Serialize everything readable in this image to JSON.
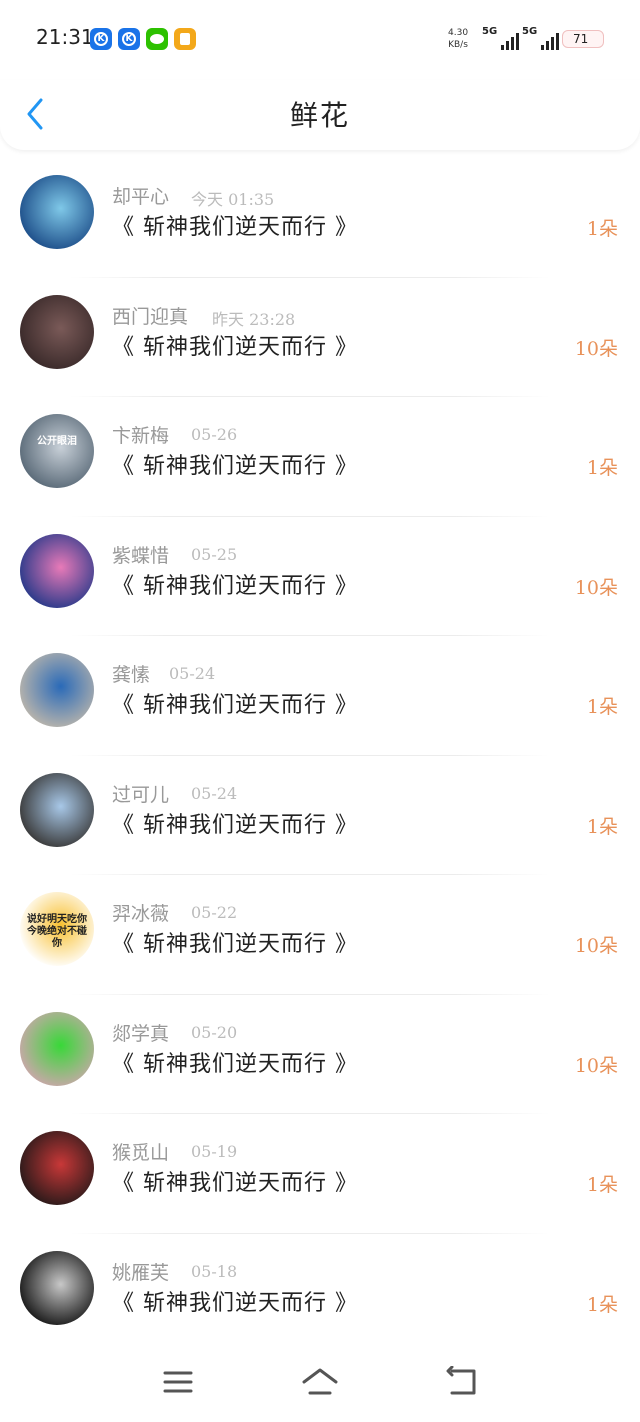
{
  "status_bar": {
    "time": "21:31",
    "net_speed_value": "4.30",
    "net_speed_unit": "KB/s",
    "signal1": "5G",
    "signal2": "5G",
    "battery": "71"
  },
  "header": {
    "title": "鲜花",
    "back_icon": "chevron-left-icon"
  },
  "entries": [
    {
      "name": "却平心",
      "date": "今天 01:35",
      "book": "《 斩神我们逆天而行 》",
      "amount": "1朵",
      "avatar_colors": [
        "#1e4f8a",
        "#7fc8e8"
      ]
    },
    {
      "name": "西门迎真",
      "date": "昨天 23:28",
      "book": "《 斩神我们逆天而行 》",
      "amount": "10朵",
      "avatar_colors": [
        "#3a2a2a",
        "#7a5a58"
      ]
    },
    {
      "name": "卞新梅",
      "date": "05-26",
      "book": "《 斩神我们逆天而行 》",
      "amount": "1朵",
      "avatar_colors": [
        "#5a6a78",
        "#c8d0d8"
      ],
      "avatar_text": "公开眼泪"
    },
    {
      "name": "紫蝶惜",
      "date": "05-25",
      "book": "《 斩神我们逆天而行 》",
      "amount": "10朵",
      "avatar_colors": [
        "#2a3a8a",
        "#e87ab8"
      ]
    },
    {
      "name": "龚愫",
      "date": "05-24",
      "book": "《 斩神我们逆天而行 》",
      "amount": "1朵",
      "avatar_colors": [
        "#b8b4ac",
        "#2a6ab8"
      ]
    },
    {
      "name": "过可儿",
      "date": "05-24",
      "book": "《 斩神我们逆天而行 》",
      "amount": "1朵",
      "avatar_colors": [
        "#3a3a3a",
        "#a8c8e8"
      ]
    },
    {
      "name": "羿冰薇",
      "date": "05-22",
      "book": "《 斩神我们逆天而行 》",
      "amount": "10朵",
      "avatar_colors": [
        "#ffffff",
        "#f8c030"
      ],
      "avatar_text": "说好明天吃你 今晚绝对不碰你"
    },
    {
      "name": "郯学真",
      "date": "05-20",
      "book": "《 斩神我们逆天而行 》",
      "amount": "10朵",
      "avatar_colors": [
        "#c8a8a8",
        "#38d838"
      ]
    },
    {
      "name": "猴觅山",
      "date": "05-19",
      "book": "《 斩神我们逆天而行 》",
      "amount": "1朵",
      "avatar_colors": [
        "#2a1a1a",
        "#c83838"
      ]
    },
    {
      "name": "姚雁芙",
      "date": "05-18",
      "book": "《 斩神我们逆天而行 》",
      "amount": "1朵",
      "avatar_colors": [
        "#1a1a1a",
        "#c8c8c8"
      ]
    }
  ],
  "nav": {
    "menu_icon": "menu-icon",
    "home_icon": "home-icon",
    "back_icon": "back-icon"
  },
  "colors": {
    "accent": "#e8925a",
    "back_arrow": "#2196f3"
  }
}
